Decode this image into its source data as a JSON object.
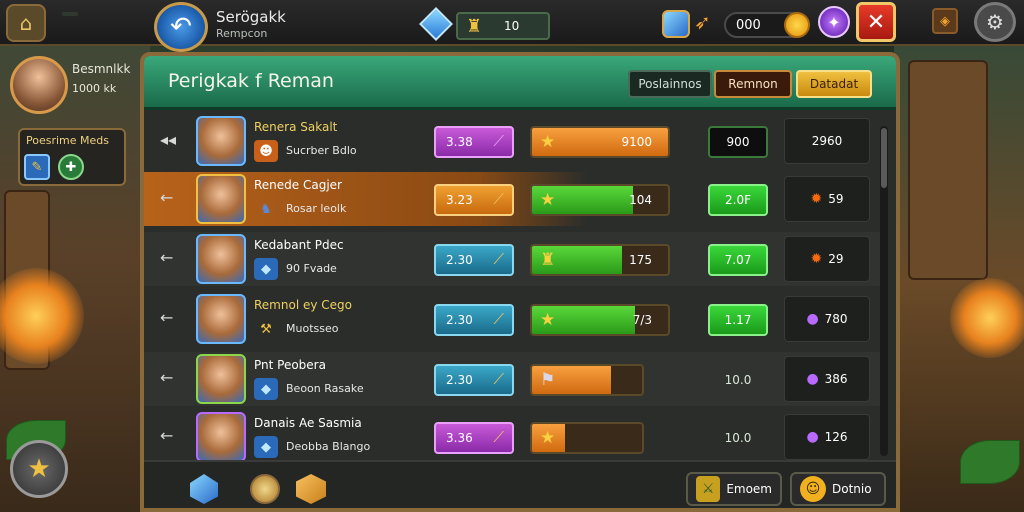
{
  "topbar": {
    "left_label": "",
    "title": "Serögakk",
    "subtitle": "Rempcon",
    "counter_value": "10",
    "coins_value": "000",
    "back_icon": "back-arrow-icon",
    "close_icon": "close-icon",
    "settings_icon": "gear-icon"
  },
  "profile": {
    "name": "Besmnlkk",
    "score": "1000 kk"
  },
  "side_panel": {
    "title": "Poesrime Meds"
  },
  "panel": {
    "title": "Perigkak f Reman",
    "tabs": [
      "Poslainnos",
      "Remnon",
      "Datadat"
    ]
  },
  "rows": [
    {
      "name": "Renera Sakalt",
      "sub": "Sucrber Bdlo",
      "pill": "3.38",
      "bar_value": "9100",
      "bar_fill": 1.0,
      "score": "900",
      "rank": "2960"
    },
    {
      "name": "Renede Cagjer",
      "sub": "Rosar leolk",
      "pill": "3.23",
      "bar_value": "104",
      "bar_fill": 0.74,
      "score": "2.0F",
      "rank": "59"
    },
    {
      "name": "Kedabant Pdec",
      "sub": "90 Fvade",
      "pill": "2.30",
      "bar_value": "175",
      "bar_fill": 0.66,
      "score": "7.07",
      "rank": "29"
    },
    {
      "name": "Remnol ey Cego",
      "sub": "Muotsseo",
      "pill": "2.30",
      "bar_value": "7/3",
      "bar_fill": 0.76,
      "score": "1.17",
      "rank": "780"
    },
    {
      "name": "Pnt Peobera",
      "sub": "Beoon Rasake",
      "pill": "2.30",
      "bar_value": "",
      "bar_fill": 0.72,
      "score": "10.0",
      "rank": "386"
    },
    {
      "name": "Danais Ae Sasmia",
      "sub": "Deobba Blango",
      "pill": "3.36",
      "bar_value": "",
      "bar_fill": 0.3,
      "score": "10.0",
      "rank": "126"
    }
  ],
  "footer": {
    "btn1_label": "Emoem",
    "btn2_label": "Dotnio"
  },
  "colors": {
    "header_green": "#2a8a5a",
    "frame_gold": "#8a6a3a",
    "accent_orange": "#f0a030",
    "accent_green": "#3ad83a"
  }
}
